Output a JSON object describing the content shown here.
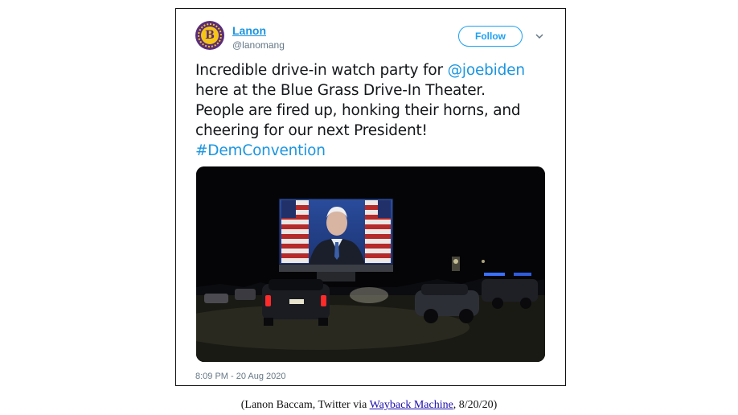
{
  "tweet": {
    "display_name": "Lanon",
    "handle": "@lanomang",
    "avatar_letter": "B",
    "follow_label": "Follow",
    "text_lines": [
      [
        {
          "t": "Incredible drive-in watch party for "
        },
        {
          "t": "@joebiden",
          "link": true
        }
      ],
      [
        {
          "t": "here at the Blue Grass Drive-In Theater."
        }
      ],
      [
        {
          "t": "People are fired up, honking their horns, and"
        }
      ],
      [
        {
          "t": "cheering for our next President!"
        }
      ],
      [
        {
          "t": "#DemConvention",
          "link": true
        }
      ]
    ],
    "timestamp": "8:09 PM - 20 Aug 2020"
  },
  "caption": {
    "prefix": "(Lanon Baccam, Twitter via ",
    "link_text": "Wayback Machine",
    "suffix": ", 8/20/20)"
  },
  "colors": {
    "link": "#1b95e0",
    "follow_border": "#1da1f2",
    "avatar_bg": "#5a2d7a",
    "avatar_fg": "#f5c518"
  }
}
